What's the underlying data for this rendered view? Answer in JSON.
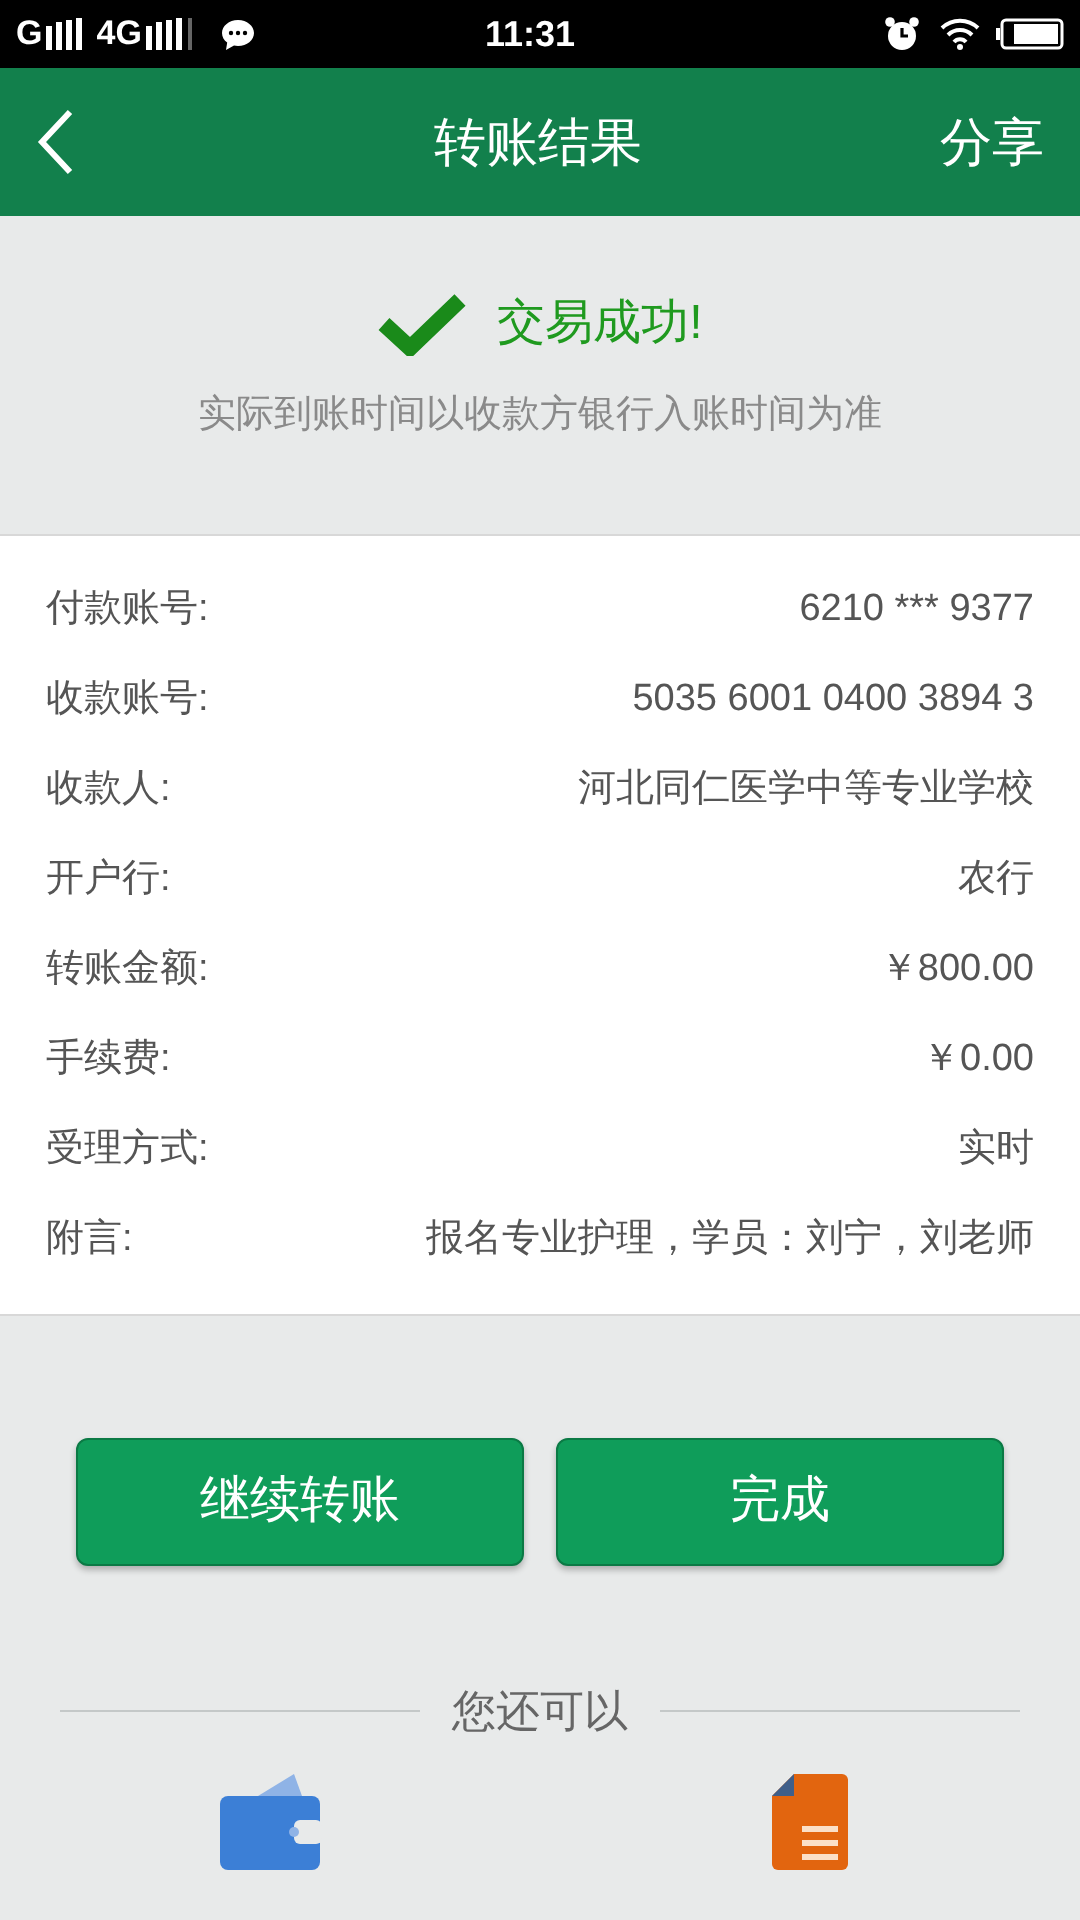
{
  "status_bar": {
    "network_1": "G",
    "network_2": "4G",
    "time": "11:31"
  },
  "header": {
    "title": "转账结果",
    "action": "分享"
  },
  "result": {
    "title": "交易成功!",
    "note": "实际到账时间以收款方银行入账时间为准"
  },
  "details": [
    {
      "label": "付款账号:",
      "value": "6210 *** 9377"
    },
    {
      "label": "收款账号:",
      "value": "5035 6001 0400 3894 3"
    },
    {
      "label": "收款人:",
      "value": "河北同仁医学中等专业学校"
    },
    {
      "label": "开户行:",
      "value": "农行"
    },
    {
      "label": "转账金额:",
      "value": "￥800.00"
    },
    {
      "label": "手续费:",
      "value": "￥0.00"
    },
    {
      "label": "受理方式:",
      "value": "实时"
    },
    {
      "label": "附言:",
      "value": "报名专业护理，学员：刘宁，刘老师"
    }
  ],
  "buttons": [
    "继续转账",
    "完成"
  ],
  "more": {
    "title": "您还可以",
    "shortcuts": [
      {
        "kind": "wallet"
      },
      {
        "kind": "document"
      }
    ]
  }
}
